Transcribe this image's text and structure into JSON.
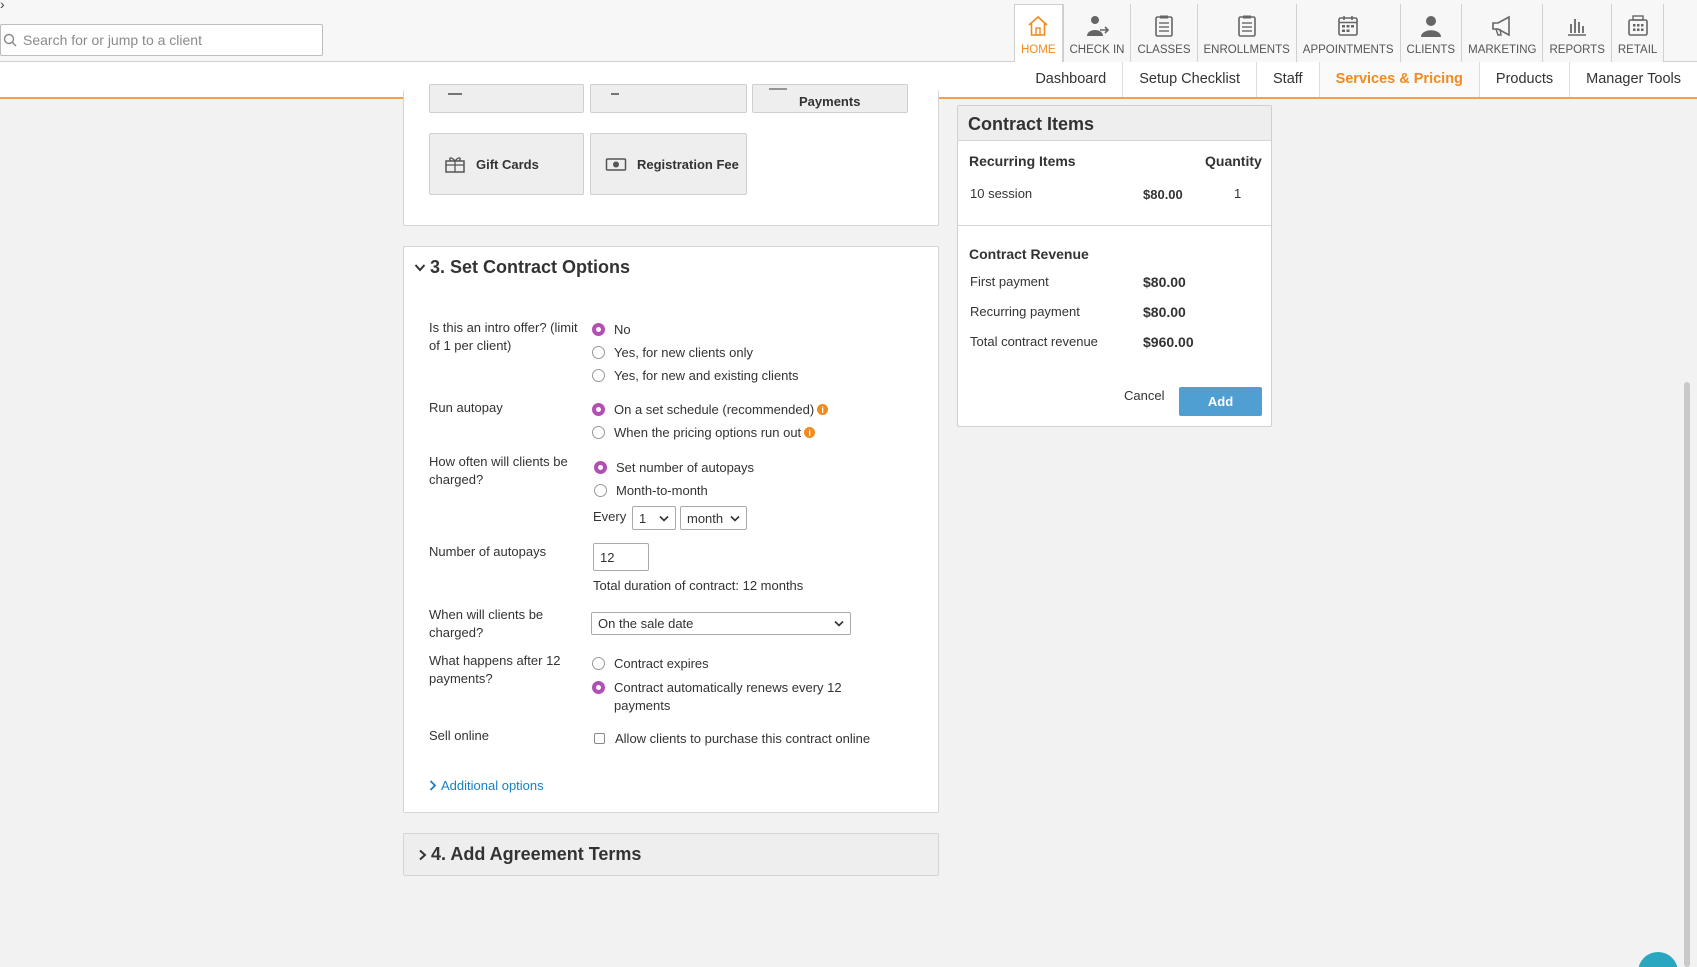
{
  "search": {
    "placeholder": "Search for or jump to a client"
  },
  "nav": {
    "items": [
      {
        "label": "HOME",
        "icon": "home-icon"
      },
      {
        "label": "CHECK IN",
        "icon": "check-in-icon"
      },
      {
        "label": "CLASSES",
        "icon": "clipboard-icon"
      },
      {
        "label": "ENROLLMENTS",
        "icon": "clipboard-icon"
      },
      {
        "label": "APPOINTMENTS",
        "icon": "calendar-icon"
      },
      {
        "label": "CLIENTS",
        "icon": "person-icon"
      },
      {
        "label": "MARKETING",
        "icon": "megaphone-icon"
      },
      {
        "label": "REPORTS",
        "icon": "bar-chart-icon"
      },
      {
        "label": "RETAIL",
        "icon": "register-icon"
      }
    ],
    "accent_color": "#f28a1e"
  },
  "subnav": {
    "items": [
      "Dashboard",
      "Setup Checklist",
      "Staff",
      "Services & Pricing",
      "Products",
      "Manager Tools"
    ],
    "active": "Services & Pricing"
  },
  "tiles": {
    "partial_label": "Payments",
    "gift_cards": "Gift Cards",
    "registration_fee": "Registration Fee"
  },
  "options": {
    "title": "3. Set Contract Options",
    "intro_label": "Is this an intro offer? (limit of 1 per client)",
    "intro_no": "No",
    "intro_new": "Yes, for new clients only",
    "intro_all": "Yes, for new and existing clients",
    "autopay_label": "Run autopay",
    "autopay_schedule": "On a set schedule (recommended)",
    "autopay_runout": "When the pricing options run out",
    "often_label": "How often will clients be charged?",
    "often_set": "Set number of autopays",
    "often_month": "Month-to-month",
    "every_label": "Every",
    "every_value": "1",
    "every_unit": "month",
    "num_label": "Number of autopays",
    "num_value": "12",
    "duration_text": "Total duration of contract: 12 months",
    "when_label": "When will clients be charged?",
    "when_value": "On the sale date",
    "after_label": "What happens after 12 payments?",
    "after_expires": "Contract expires",
    "after_renews": "Contract automatically renews every 12 payments",
    "online_label": "Sell online",
    "online_check": "Allow clients to purchase this contract online",
    "additional_link": "Additional options",
    "radio_color": "#b14fb4"
  },
  "agreement": {
    "title": "4. Add Agreement Terms"
  },
  "contract_items": {
    "title": "Contract Items",
    "col_items": "Recurring Items",
    "col_qty": "Quantity",
    "item_name": "10 session",
    "item_price": "$80.00",
    "item_qty": "1",
    "revenue_title": "Contract Revenue",
    "first_label": "First payment",
    "first_value": "$80.00",
    "recurring_label": "Recurring payment",
    "recurring_value": "$80.00",
    "total_label": "Total contract revenue",
    "total_value": "$960.00",
    "cancel": "Cancel",
    "add": "Add",
    "add_color": "#4f9fd2"
  }
}
